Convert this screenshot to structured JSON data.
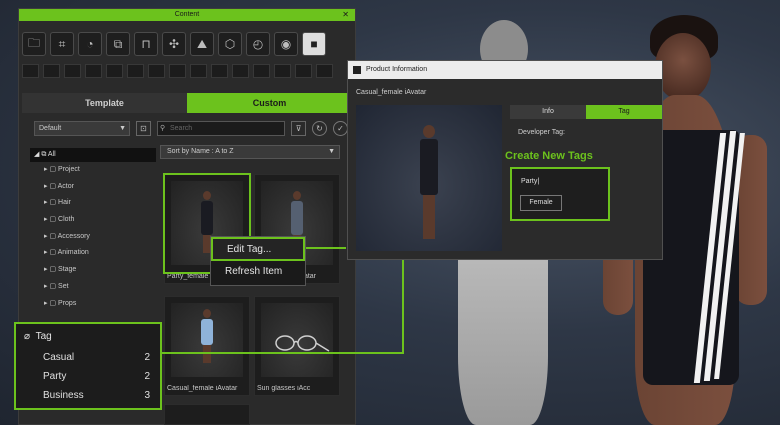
{
  "panel": {
    "title": "Content",
    "close_glyph": "✕",
    "toolbar_icons": [
      "folder-icon",
      "body-icon",
      "head-icon",
      "clothing-icon",
      "chair-icon",
      "pose-icon",
      "image-icon",
      "accessory-icon",
      "pie-icon",
      "gamepad-icon",
      "square-icon"
    ],
    "toolbar_glyphs": [
      "🗀",
      "⌗",
      "◔",
      "⧉",
      "⊓",
      "✣",
      "⛰",
      "⬡",
      "◴",
      "◉",
      "■"
    ],
    "tabs": [
      {
        "label": "Template",
        "active": false
      },
      {
        "label": "Custom",
        "active": true
      }
    ],
    "default_dropdown": "Default",
    "search_placeholder": "Search",
    "sort_label": "Sort by Name : A to Z",
    "tree_root": "All",
    "tree_items": [
      "Project",
      "Actor",
      "Hair",
      "Cloth",
      "Accessory",
      "Animation",
      "Stage",
      "Set",
      "Props"
    ],
    "thumbnails": [
      {
        "caption": "Party_female iAvatar",
        "body_color": "#1a1b22"
      },
      {
        "caption": "Party_male iAvatar",
        "body_color": "#556071"
      },
      {
        "caption": "Casual_female iAvatar",
        "body_color": "#8fb3d9"
      },
      {
        "caption": "Sun glasses iAcc",
        "body_color": "none"
      }
    ]
  },
  "context_menu": {
    "items": [
      "Edit Tag...",
      "Refresh Item"
    ]
  },
  "tag_panel": {
    "header": "Tag",
    "rows": [
      {
        "name": "Casual",
        "count": "2"
      },
      {
        "name": "Party",
        "count": "2"
      },
      {
        "name": "Business",
        "count": "3"
      }
    ]
  },
  "product_info": {
    "title": "Product Information",
    "filename": "Casual_female iAvatar",
    "tabs": [
      {
        "label": "Info",
        "active": false
      },
      {
        "label": "Tag",
        "active": true
      }
    ],
    "developer_tag_label": "Developer Tag:",
    "tag_input_value": "Party|",
    "tag_chip": "Female"
  },
  "callout": "Create New Tags",
  "colors": {
    "accent": "#6cc21d",
    "panel_bg": "#2a2a2a"
  }
}
